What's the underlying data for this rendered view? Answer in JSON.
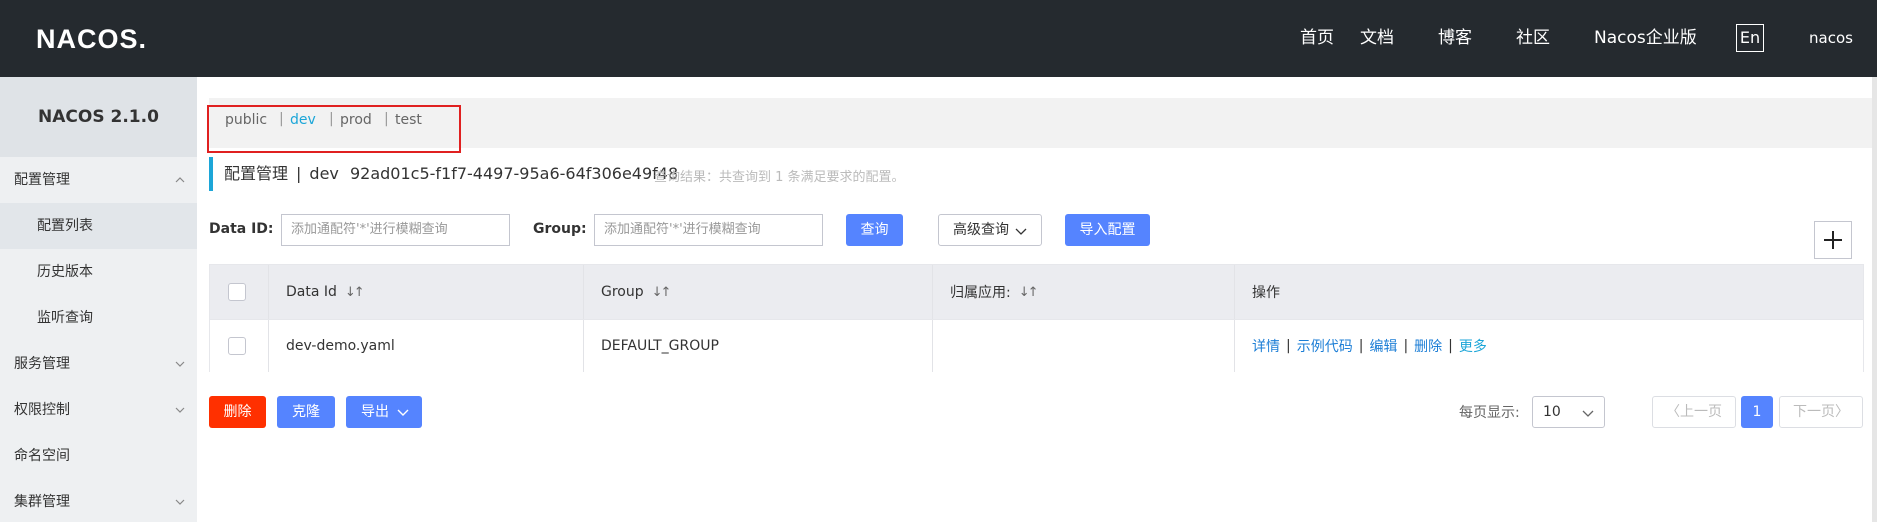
{
  "header": {
    "logo": "NACOS.",
    "nav": [
      "首页",
      "文档",
      "博客",
      "社区",
      "Nacos企业版"
    ],
    "lang": "En",
    "user": "nacos"
  },
  "sidebar": {
    "version": "NACOS 2.1.0",
    "items": [
      {
        "label": "配置管理",
        "expanded": true
      },
      {
        "label": "配置列表"
      },
      {
        "label": "历史版本"
      },
      {
        "label": "监听查询"
      },
      {
        "label": "服务管理"
      },
      {
        "label": "权限控制"
      },
      {
        "label": "命名空间"
      },
      {
        "label": "集群管理"
      }
    ]
  },
  "namespaces": [
    "public",
    "dev",
    "prod",
    "test"
  ],
  "namespace_separator": "|",
  "active_namespace": "dev",
  "title": {
    "section": "配置管理",
    "sep": "|",
    "namespace": "dev",
    "namespace_id": "92ad01c5-f1f7-4497-95a6-64f306e49f48",
    "result": "查询结果：共查询到 1 条满足要求的配置。"
  },
  "search": {
    "data_id_label": "Data ID:",
    "data_id_placeholder": "添加通配符'*'进行模糊查询",
    "group_label": "Group:",
    "group_placeholder": "添加通配符'*'进行模糊查询",
    "query_btn": "查询",
    "advanced_btn": "高级查询",
    "import_btn": "导入配置"
  },
  "table": {
    "headers": [
      "Data Id",
      "Group",
      "归属应用:",
      "操作"
    ],
    "sort_icon": "↓↑",
    "rows": [
      {
        "data_id": "dev-demo.yaml",
        "group": "DEFAULT_GROUP",
        "app": ""
      }
    ],
    "ops": [
      "详情",
      "示例代码",
      "编辑",
      "删除",
      "更多"
    ],
    "op_sep": "|"
  },
  "actions": {
    "delete": "删除",
    "clone": "克隆",
    "export": "导出"
  },
  "pagination": {
    "page_size_label": "每页显示:",
    "page_size": "10",
    "prev": "上一页",
    "current": "1",
    "next": "下一页"
  },
  "colors": {
    "header_bg": "#252a2f",
    "accent": "#1ca6d8",
    "primary_btn": "#5584ff",
    "danger_btn": "#ff3000",
    "highlight_box": "#e02020"
  }
}
